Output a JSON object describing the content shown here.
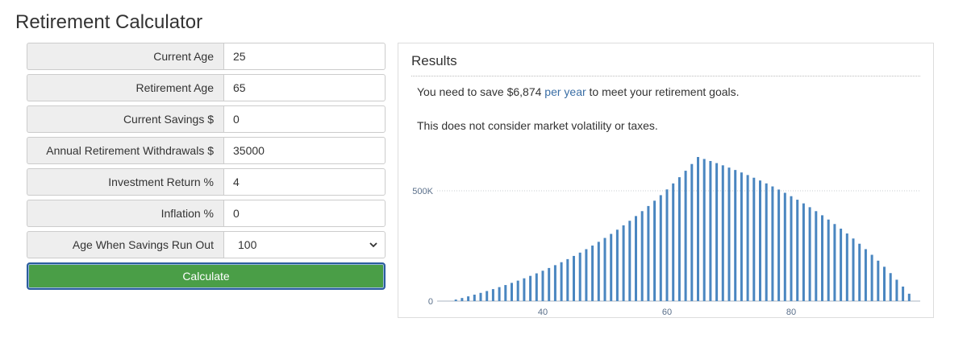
{
  "page": {
    "title": "Retirement Calculator"
  },
  "form": {
    "fields": [
      {
        "label": "Current Age",
        "value": "25"
      },
      {
        "label": "Retirement Age",
        "value": "65"
      },
      {
        "label": "Current Savings $",
        "value": "0"
      },
      {
        "label": "Annual Retirement Withdrawals $",
        "value": "35000"
      },
      {
        "label": "Investment Return %",
        "value": "4"
      },
      {
        "label": "Inflation %",
        "value": "0"
      }
    ],
    "select": {
      "label": "Age When Savings Run Out",
      "value": "100"
    },
    "calculate_label": "Calculate"
  },
  "results": {
    "title": "Results",
    "line1_prefix": "You need to save ",
    "line1_amount": "$6,874",
    "line1_per": " per year",
    "line1_suffix": " to meet your retirement goals.",
    "line2": "This does not consider market volatility or taxes."
  },
  "colors": {
    "bar": "#4a86c0",
    "button": "#4a9e47",
    "accent": "#3a6ea5"
  },
  "chart_data": {
    "type": "bar",
    "x_start": 26,
    "x_end": 99,
    "contribution": 6874,
    "rate": 0.04,
    "retire_age": 65,
    "withdrawal": 35000,
    "y_ticks": [
      {
        "value": 0,
        "label": "0"
      },
      {
        "value": 500000,
        "label": "500K"
      }
    ],
    "x_ticks": [
      {
        "value": 40,
        "label": "40"
      },
      {
        "value": 60,
        "label": "60"
      },
      {
        "value": 80,
        "label": "80"
      }
    ],
    "grid": true
  }
}
